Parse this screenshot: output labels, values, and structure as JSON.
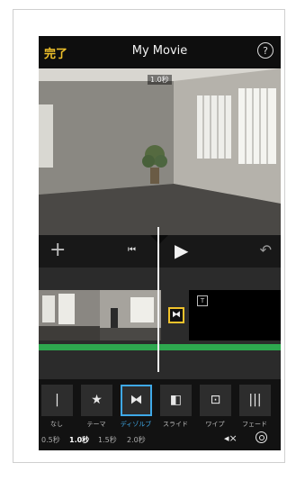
{
  "header": {
    "done_label": "完了",
    "title": "My Movie",
    "help_label": "?"
  },
  "preview": {
    "timecode": "1.0秒"
  },
  "toolbar": {
    "add_label": "+",
    "skip_label": "⏮",
    "play_label": "▶",
    "undo_label": "↶"
  },
  "timeline": {
    "title_badge": "T",
    "transition_symbol": "⧓"
  },
  "transitions": {
    "items": [
      {
        "symbol": "|",
        "label": "なし"
      },
      {
        "symbol": "★",
        "label": "テーマ"
      },
      {
        "symbol": "⧓",
        "label": "ディゾルブ"
      },
      {
        "symbol": "◧",
        "label": "スライド"
      },
      {
        "symbol": "⊡",
        "label": "ワイプ"
      },
      {
        "symbol": "|||",
        "label": "フェード"
      }
    ],
    "selected_index": 2
  },
  "durations": {
    "items": [
      "0.5秒",
      "1.0秒",
      "1.5秒",
      "2.0秒"
    ],
    "selected_index": 1
  },
  "colors": {
    "accent": "#f0c22b",
    "selection": "#3fa9e8",
    "audio_track": "#2ea84f"
  },
  "icons": {
    "volume": "volume-mute-icon",
    "settings": "gear-icon"
  }
}
